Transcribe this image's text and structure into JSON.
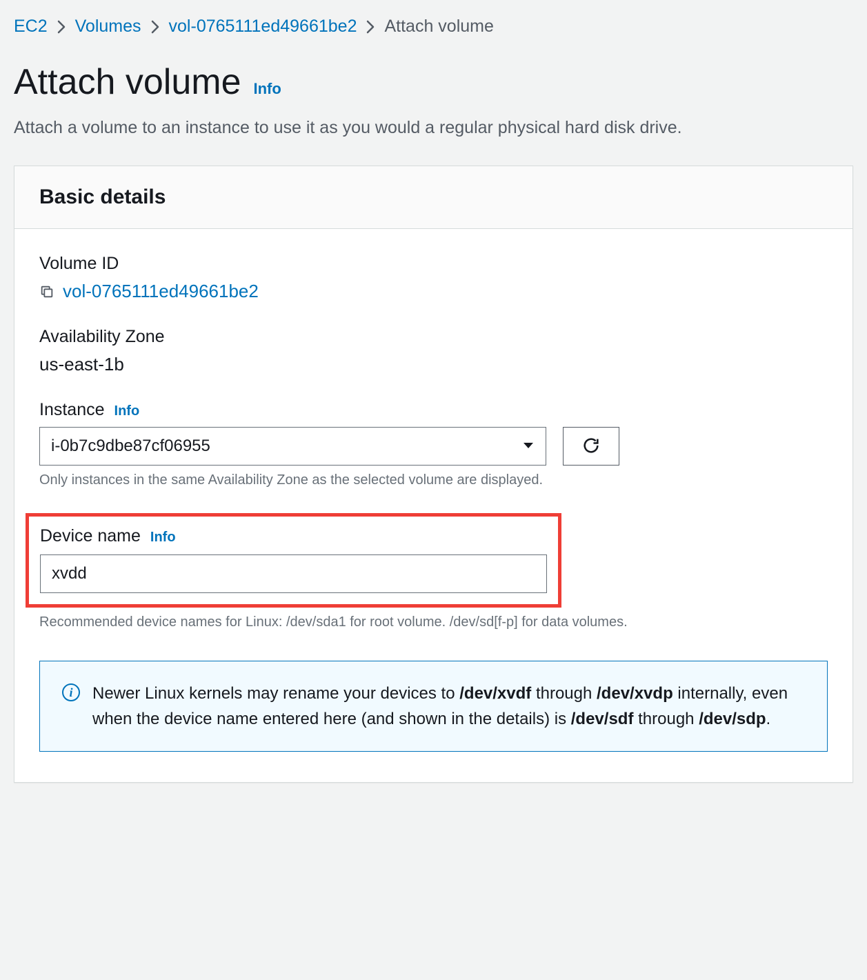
{
  "breadcrumb": {
    "items": [
      {
        "label": "EC2"
      },
      {
        "label": "Volumes"
      },
      {
        "label": "vol-0765111ed49661be2"
      }
    ],
    "current": "Attach volume"
  },
  "page": {
    "title": "Attach volume",
    "info_label": "Info",
    "description": "Attach a volume to an instance to use it as you would a regular physical hard disk drive."
  },
  "panel": {
    "title": "Basic details",
    "volume_id": {
      "label": "Volume ID",
      "value": "vol-0765111ed49661be2"
    },
    "availability_zone": {
      "label": "Availability Zone",
      "value": "us-east-1b"
    },
    "instance": {
      "label": "Instance",
      "info_label": "Info",
      "value": "i-0b7c9dbe87cf06955",
      "helper": "Only instances in the same Availability Zone as the selected volume are displayed."
    },
    "device_name": {
      "label": "Device name",
      "info_label": "Info",
      "value": "xvdd",
      "helper": "Recommended device names for Linux: /dev/sda1 for root volume. /dev/sd[f-p] for data volumes."
    },
    "callout": {
      "pre": "Newer Linux kernels may rename your devices to ",
      "bold1": "/dev/xvdf",
      "mid1": " through ",
      "bold2": "/dev/xvdp",
      "mid2": " internally, even when the device name entered here (and shown in the details) is ",
      "bold3": "/dev/sdf",
      "mid3": " through ",
      "bold4": "/dev/sdp",
      "end": "."
    }
  }
}
